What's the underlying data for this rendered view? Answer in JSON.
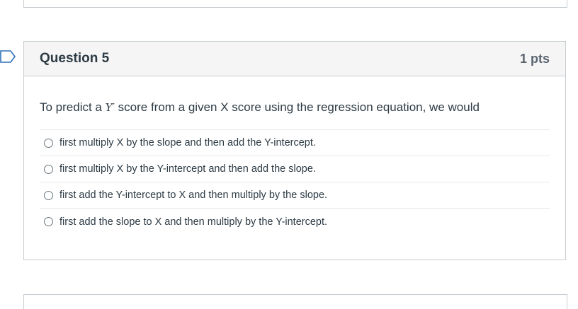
{
  "question": {
    "title": "Question 5",
    "points": "1 pts",
    "text_before": "To predict a ",
    "symbol": "Y′",
    "text_after": " score from a given X score using the regression equation, we would"
  },
  "answers": [
    {
      "label": "first multiply X  by the slope and then add the Y-intercept.",
      "selected": false
    },
    {
      "label": "first multiply X  by the Y-intercept and then add the slope.",
      "selected": false
    },
    {
      "label": "first add the Y-intercept to X and then multiply by the slope.",
      "selected": false
    },
    {
      "label": "first add the slope to X and then multiply by the Y-intercept.",
      "selected": false
    }
  ],
  "colors": {
    "flag": "#2d6fb7",
    "border": "#c7cdd1",
    "header_bg": "#f5f5f5",
    "text": "#2d3b45"
  },
  "icons": {
    "flag": "bookmark-flag-icon",
    "radio": "radio-unchecked-icon"
  }
}
